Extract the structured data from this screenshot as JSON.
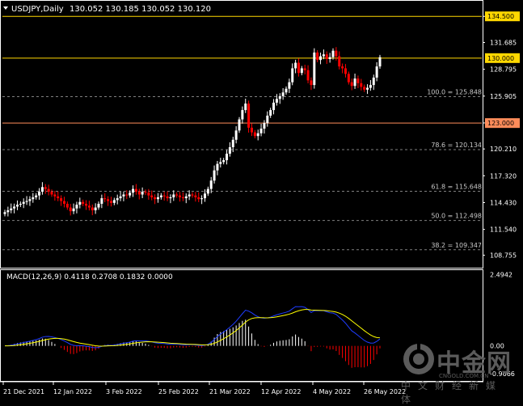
{
  "header": {
    "symbol": "USDJPY,Daily",
    "ohlc": "130.052 130.185 130.052 130.120"
  },
  "macd_label": "MACD(12,26,9) 0.4118 0.2708 0.1832 0.0000",
  "colors": {
    "background": "#000000",
    "frame": "#ffffff",
    "grid": "#808080",
    "candle_up": "#ffffff",
    "candle_down": "#ff0000",
    "resistance_line": "#ffd700",
    "support_line": "#ff8c5a",
    "macd_line": "#1e3cff",
    "signal_line": "#ffff00",
    "histogram_up": "#ffffff",
    "histogram_down": "#ff0000",
    "price_tag_bg": "#ffffff"
  },
  "chart_data": [
    {
      "type": "candlestick",
      "symbol": "USDJPY",
      "timeframe": "Daily",
      "y_ticks": [
        "134.500",
        "131.685",
        "128.795",
        "125.905",
        "123.015",
        "120.210",
        "117.320",
        "114.430",
        "111.540",
        "108.755"
      ],
      "ylim": [
        107.5,
        136.0
      ],
      "x_ticks": [
        "21 Dec 2021",
        "12 Jan 2022",
        "3 Feb 2022",
        "25 Feb 2022",
        "21 Mar 2022",
        "12 Apr 2022",
        "4 May 2022",
        "26 May 2022"
      ],
      "horizontal_lines": [
        {
          "label": "134.500",
          "price": 134.5,
          "color_key": "resistance_line"
        },
        {
          "label": "130.000",
          "price": 130.0,
          "color_key": "resistance_line"
        },
        {
          "label": "123.000",
          "price": 123.0,
          "color_key": "support_line"
        }
      ],
      "fibonacci": [
        {
          "label": "100.0 = 125.848",
          "price": 125.848
        },
        {
          "label": "78.6 = 120.134",
          "price": 120.134
        },
        {
          "label": "61.8 = 115.648",
          "price": 115.648
        },
        {
          "label": "50.0 = 112.498",
          "price": 112.498
        },
        {
          "label": "38.2 = 109.347",
          "price": 109.347
        }
      ],
      "close_approx": [
        113.4,
        113.6,
        113.8,
        114.0,
        114.2,
        114.3,
        114.5,
        114.6,
        114.8,
        115.0,
        115.2,
        115.6,
        116.1,
        115.9,
        115.6,
        115.3,
        115.1,
        114.9,
        114.6,
        114.3,
        113.9,
        113.5,
        113.8,
        114.2,
        114.5,
        114.3,
        114.1,
        113.9,
        113.6,
        113.9,
        114.3,
        114.9,
        114.8,
        114.6,
        114.4,
        114.7,
        114.9,
        115.1,
        115.3,
        115.2,
        115.5,
        115.9,
        115.6,
        115.3,
        115.6,
        115.5,
        115.2,
        115.0,
        114.8,
        115.0,
        115.2,
        115.1,
        114.9,
        115.0,
        115.3,
        115.2,
        115.0,
        114.9,
        115.1,
        115.3,
        115.2,
        115.0,
        114.8,
        114.9,
        115.4,
        115.9,
        116.8,
        117.9,
        118.6,
        118.8,
        119.0,
        119.7,
        120.4,
        121.2,
        122.2,
        123.4,
        124.4,
        125.1,
        122.5,
        122.0,
        121.6,
        121.9,
        122.4,
        123.0,
        123.8,
        124.4,
        125.2,
        125.6,
        125.9,
        126.3,
        126.7,
        127.4,
        128.9,
        129.5,
        128.4,
        128.9,
        128.7,
        127.6,
        127.1,
        130.6,
        129.8,
        130.2,
        130.4,
        129.9,
        130.1,
        130.8,
        130.2,
        129.1,
        128.9,
        128.3,
        127.4,
        127.0,
        127.8,
        127.3,
        126.9,
        126.6,
        126.8,
        127.1,
        127.9,
        129.1,
        130.1
      ]
    },
    {
      "type": "macd",
      "params": "MACD(12,26,9)",
      "values": {
        "macd": 0.4118,
        "signal": 0.2708,
        "histogram": 0.1832,
        "zero": 0.0
      },
      "y_ticks": [
        "2.4942",
        "0.00",
        "-0.9666"
      ],
      "ylim": [
        -1.2,
        2.6
      ]
    }
  ],
  "watermark": {
    "name": "中金网",
    "url": "CNGOLD.COM.CN",
    "subtitle": "中文财经新媒体"
  }
}
